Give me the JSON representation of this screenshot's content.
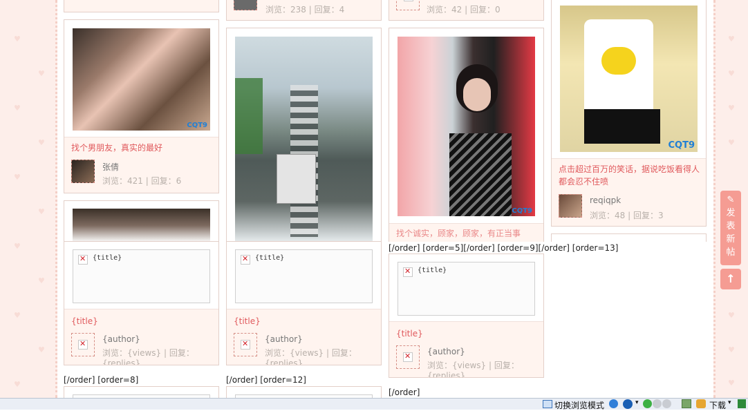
{
  "cards": [
    {
      "title": "",
      "meta": "浏览：238 | 回复：4"
    },
    {
      "title": "",
      "meta": "浏览：42 | 回复：0"
    },
    {
      "title": "找个男朋友，真实的最好",
      "author": "张倩",
      "meta": "浏览：421 | 回复：6"
    },
    {
      "title": "点击超过百万的笑话，据说吃饭看得人都会忍不住喷",
      "author": "reqiqpk",
      "meta": "浏览：48 | 回复：3"
    },
    {
      "title": "找个诚实，顾家，顾家，有正当事"
    }
  ],
  "watermark": "CQT9",
  "template_cards": [
    {
      "title_ph": "{title}",
      "ptitle": "{title}",
      "author": "{author}",
      "meta": "浏览：{views} | 回复：{replies}"
    },
    {
      "title_ph": "{title}",
      "ptitle": "{title}",
      "author": "{author}",
      "meta": "浏览：{views} | 回复：{replies}"
    },
    {
      "title_ph": "{title}",
      "ptitle": "{title}",
      "author": "{author}",
      "meta": "浏览：{views} | 回复：{replies}"
    }
  ],
  "order_texts": [
    "[/order] [order=5][/order] [order=9][/order] [order=13]",
    "[/order] [order=8]",
    "[/order] [order=12]",
    "[/order]"
  ],
  "fab": {
    "post_label": "发表新帖",
    "top_label": "↑"
  },
  "statusbar": {
    "switch_mode": "切换浏览模式",
    "download": "下载"
  },
  "colors": {
    "accent": "#e0595c",
    "bg": "#fdeeea",
    "fab": "#f59c93"
  }
}
